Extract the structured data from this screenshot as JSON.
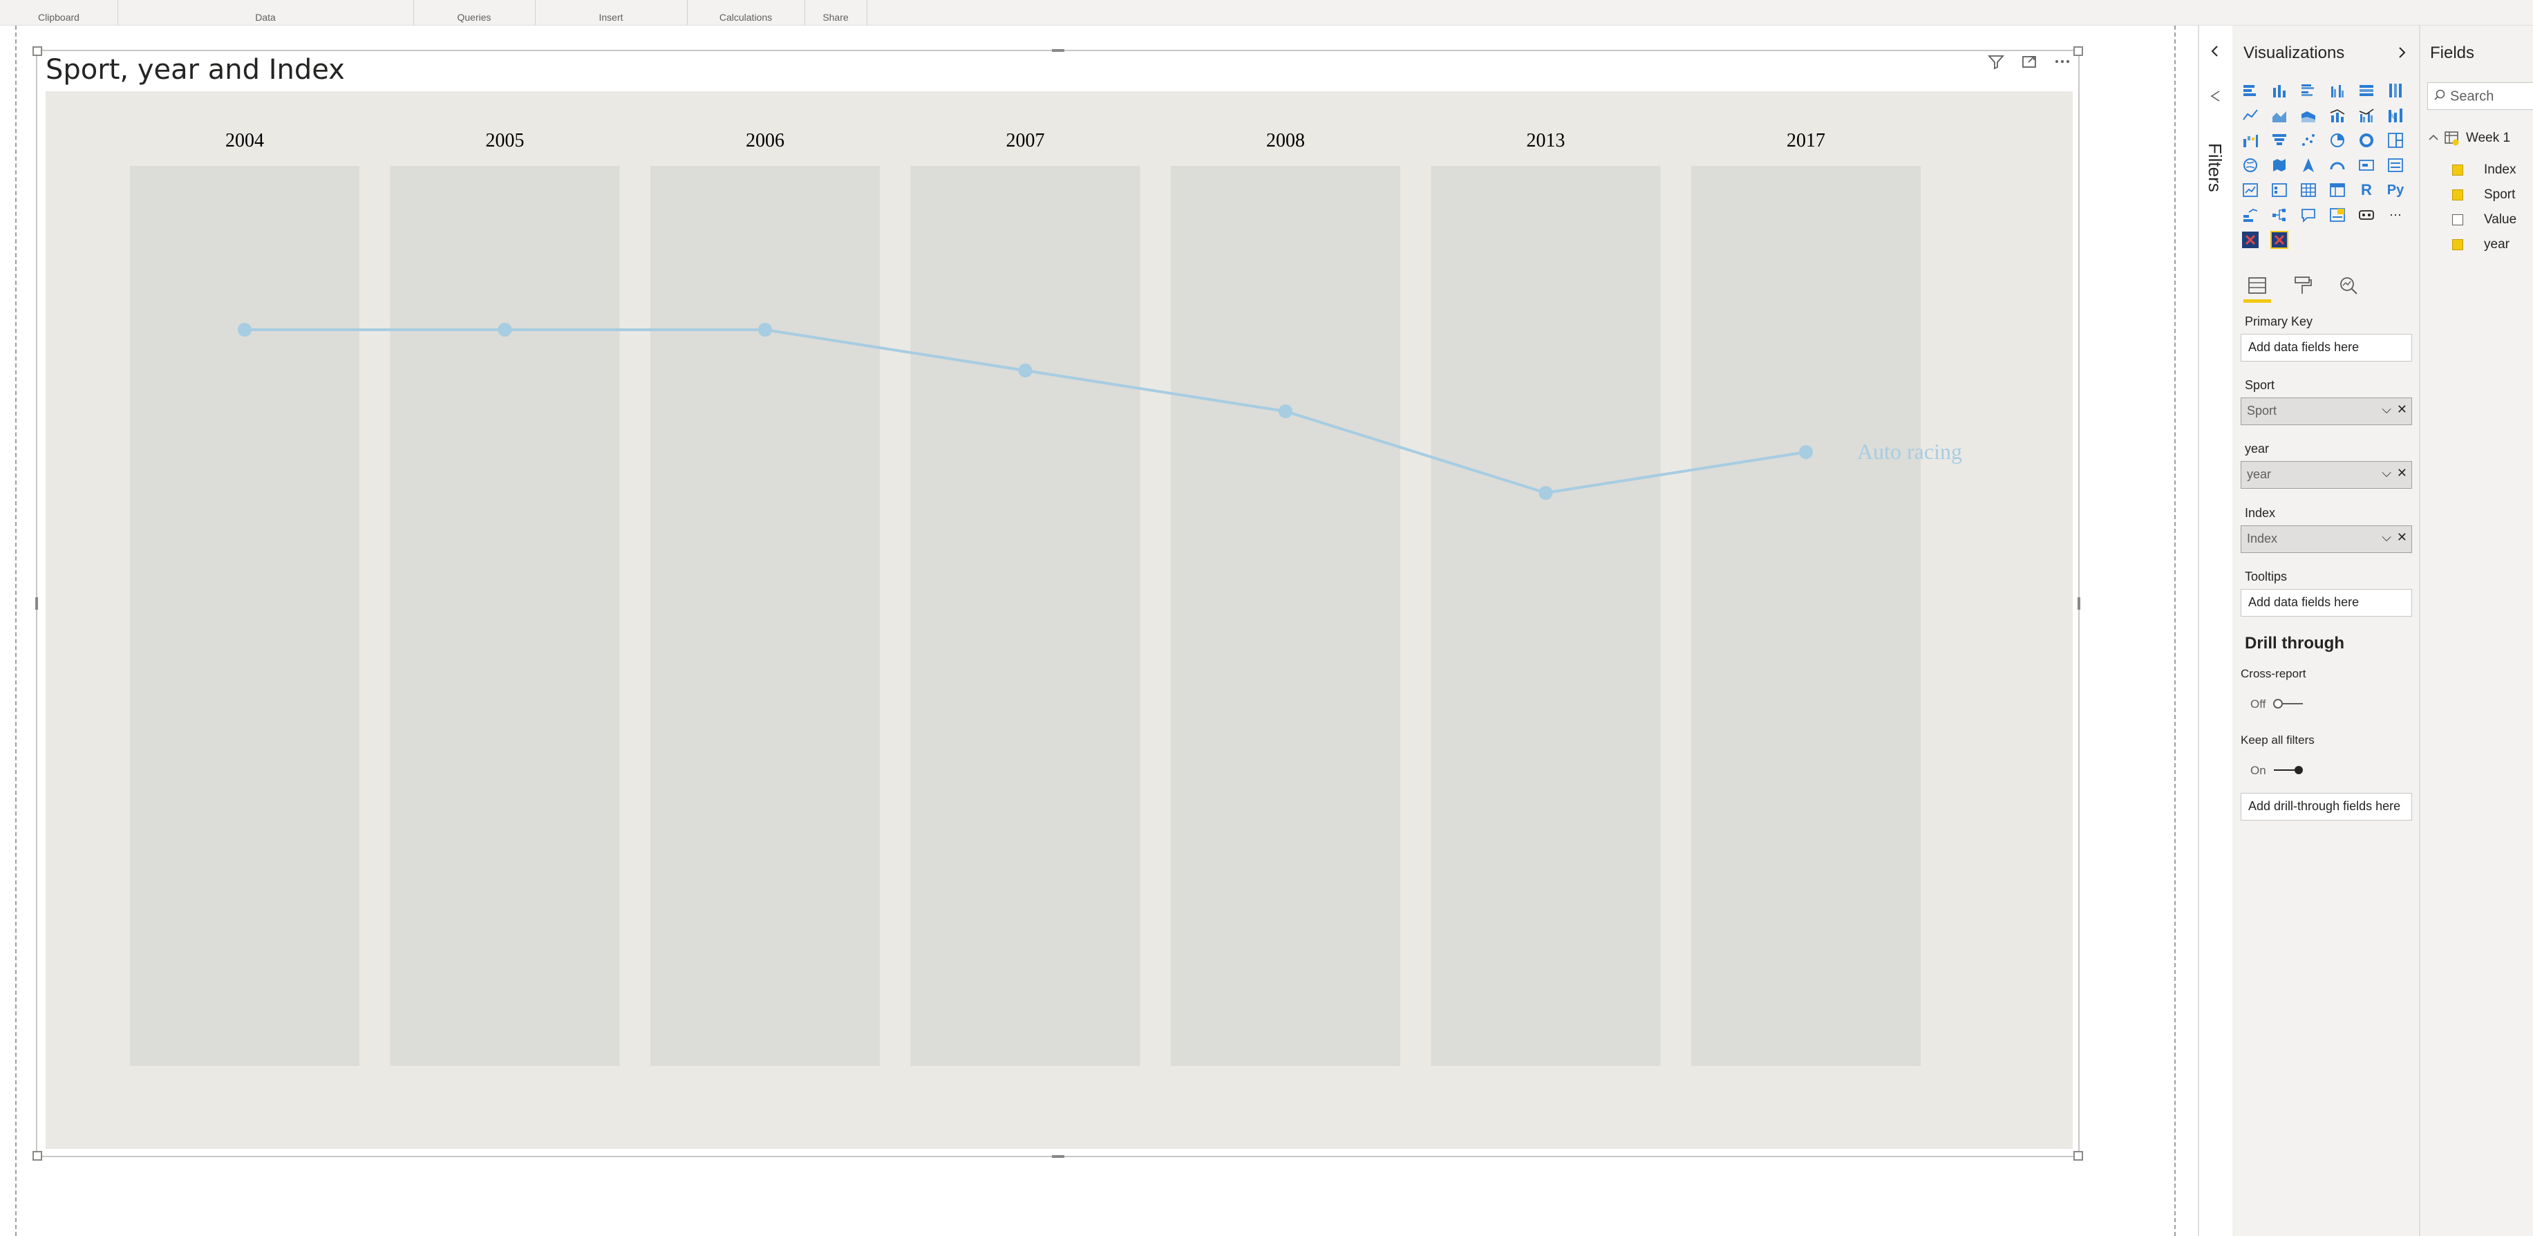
{
  "ribbon": {
    "groups": [
      "Clipboard",
      "Data",
      "Queries",
      "Insert",
      "Calculations",
      "Share"
    ]
  },
  "visual": {
    "title": "Sport, year and Index",
    "icons": [
      "filter-icon",
      "focus-mode-icon",
      "more-options-icon"
    ]
  },
  "chart_data": {
    "type": "line",
    "categories": [
      "2004",
      "2005",
      "2006",
      "2007",
      "2008",
      "2013",
      "2017"
    ],
    "series": [
      {
        "name": "Auto racing",
        "values": [
          4,
          4,
          4,
          5,
          6,
          8,
          7
        ]
      }
    ],
    "y_axis_inverted": true,
    "ylim": [
      1,
      16
    ],
    "colors": {
      "line": "#a6cde2",
      "background": "#ebe9e4",
      "band": "#dcdcd8",
      "category_text": "#000000"
    },
    "grid": false,
    "legend": "none"
  },
  "filters_pane": {
    "label": "Filters"
  },
  "visualizations_pane": {
    "title": "Visualizations",
    "tabs": [
      "fields-tab",
      "format-tab",
      "analytics-tab"
    ],
    "wells": {
      "primary_key": {
        "label": "Primary Key",
        "placeholder": "Add data fields here"
      },
      "sport": {
        "label": "Sport",
        "value": "Sport"
      },
      "year": {
        "label": "year",
        "value": "year"
      },
      "index": {
        "label": "Index",
        "value": "Index"
      },
      "tooltips": {
        "label": "Tooltips",
        "placeholder": "Add data fields here"
      }
    },
    "drill_through": {
      "title": "Drill through",
      "cross_report": {
        "label": "Cross-report",
        "state": "Off"
      },
      "keep_all_filters": {
        "label": "Keep all filters",
        "state": "On"
      },
      "placeholder": "Add drill-through fields here"
    }
  },
  "fields_pane": {
    "title": "Fields",
    "search_placeholder": "Search",
    "table": "Week 1",
    "fields": [
      {
        "name": "Index",
        "checked": true
      },
      {
        "name": "Sport",
        "checked": true
      },
      {
        "name": "Value",
        "checked": false
      },
      {
        "name": "year",
        "checked": true
      }
    ]
  }
}
